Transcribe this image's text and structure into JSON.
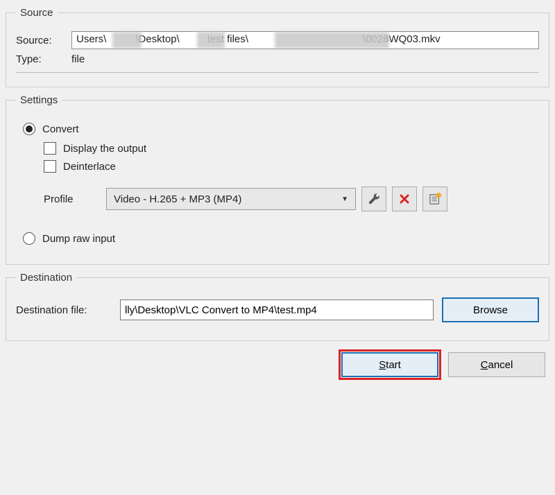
{
  "source": {
    "legend": "Source",
    "label": "Source:",
    "path_prefix": "Users\\",
    "path_mid1": "\\Desktop\\",
    "path_mid2": "test files\\",
    "path_suffix": "\\0028WQ03.mkv",
    "type_label": "Type:",
    "type_value": "file"
  },
  "settings": {
    "legend": "Settings",
    "convert_label": "Convert",
    "display_output_label": "Display the output",
    "deinterlace_label": "Deinterlace",
    "profile_label": "Profile",
    "profile_value": "Video - H.265 + MP3 (MP4)",
    "dump_raw_label": "Dump raw input"
  },
  "destination": {
    "legend": "Destination",
    "label": "Destination file:",
    "value": "lly\\Desktop\\VLC Convert to MP4\\test.mp4",
    "browse_label": "Browse"
  },
  "buttons": {
    "start_prefix": "S",
    "start_rest": "tart",
    "cancel_prefix": "C",
    "cancel_rest": "ancel"
  }
}
